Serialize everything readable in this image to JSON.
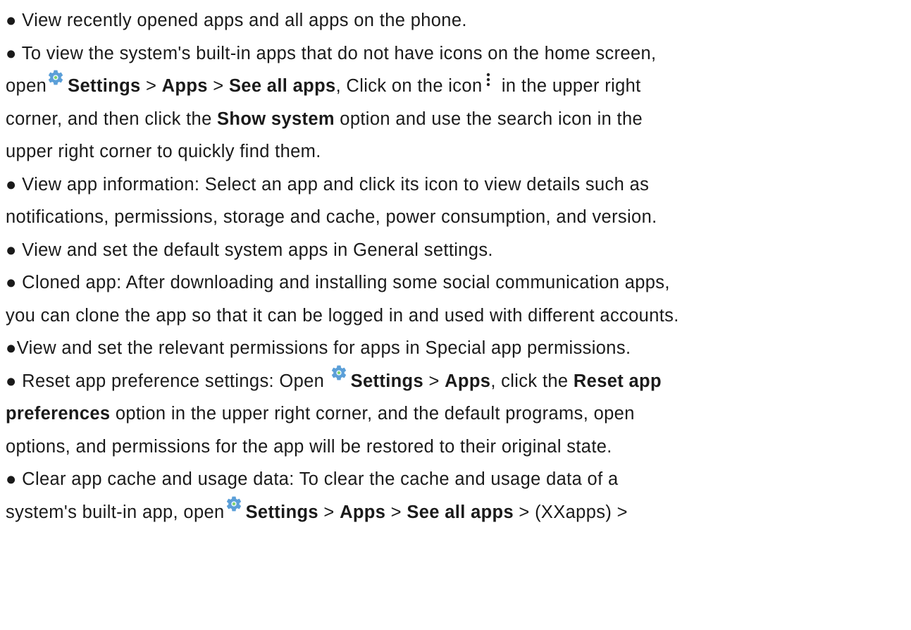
{
  "lines": {
    "l1": "● View recently opened apps and all apps on the phone.",
    "l2": "● To view the system's built-in apps that do not have icons on the home screen,",
    "l3": {
      "a": "open",
      "settings": "Settings",
      "sep1": " > ",
      "apps": "Apps",
      "sep2": " > ",
      "see_all": "See all apps",
      "b": ", Click on the icon",
      "c": " in the upper right"
    },
    "l4": {
      "a": "corner, and then click the ",
      "show_system": "Show system",
      "b": " option and use the search icon in the"
    },
    "l5": "upper right corner to quickly find them.",
    "l6": "● View app information: Select an app and click its icon to view details such as",
    "l7": "notifications, permissions, storage and cache, power consumption, and version.",
    "l8": "● View and set the default system apps in General settings.",
    "l9": "● Cloned app: After downloading and installing some social communication apps,",
    "l10": "you can clone the app so that it can be logged in and used with different accounts.",
    "l11": "●View and set the relevant permissions for apps in Special app permissions.",
    "l12": {
      "a": "● Reset app preference settings: Open ",
      "settings": "Settings",
      "sep1": " > ",
      "apps": "Apps",
      "b": ", click the ",
      "reset": "Reset app"
    },
    "l13": {
      "preferences": "preferences",
      "a": " option in the upper right corner, and the default programs, open"
    },
    "l14": "options, and permissions for the app will be restored to their original state.",
    "l15": "● Clear app cache and usage data: To clear the cache and usage data of a",
    "l16": {
      "a": "system's built-in app, open",
      "settings": "Settings",
      "sep1": " > ",
      "apps": "Apps",
      "sep2": " > ",
      "see_all": "See all apps",
      "b": " > (XXapps) >"
    }
  },
  "icons": {
    "settings_gear": "settings-gear-icon",
    "more_options": "more-vert-icon",
    "gear_color": "#4f9ad6"
  }
}
